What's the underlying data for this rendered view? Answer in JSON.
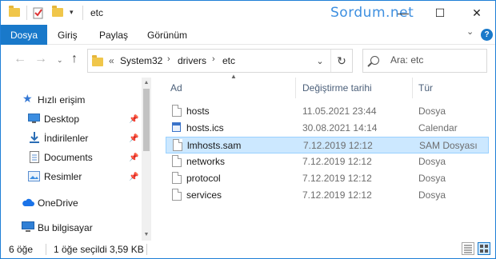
{
  "window": {
    "title": "etc",
    "watermark": "Sordum.net",
    "controls": {
      "minimize": "—",
      "maximize": "☐",
      "close": "✕"
    }
  },
  "ribbon": {
    "file_tab": "Dosya",
    "tabs": [
      "Giriş",
      "Paylaş",
      "Görünüm"
    ]
  },
  "address": {
    "prefix": "«",
    "crumbs": [
      "System32",
      "drivers",
      "etc"
    ]
  },
  "search": {
    "placeholder": "Ara: etc"
  },
  "nav_pane": {
    "quick_access": "Hızlı erişim",
    "pinned": [
      "Desktop",
      "İndirilenler",
      "Documents",
      "Resimler"
    ],
    "onedrive": "OneDrive",
    "this_pc": "Bu bilgisayar"
  },
  "file_list": {
    "columns": {
      "name": "Ad",
      "date": "Değiştirme tarihi",
      "type": "Tür"
    },
    "rows": [
      {
        "name": "hosts",
        "date": "11.05.2021 23:44",
        "type": "Dosya",
        "icon": "file-icon"
      },
      {
        "name": "hosts.ics",
        "date": "30.08.2021 14:14",
        "type": "Calendar",
        "icon": "calendar-file-icon"
      },
      {
        "name": "lmhosts.sam",
        "date": "7.12.2019 12:12",
        "type": "SAM Dosyası",
        "icon": "file-icon",
        "selected": true
      },
      {
        "name": "networks",
        "date": "7.12.2019 12:12",
        "type": "Dosya",
        "icon": "file-icon"
      },
      {
        "name": "protocol",
        "date": "7.12.2019 12:12",
        "type": "Dosya",
        "icon": "file-icon"
      },
      {
        "name": "services",
        "date": "7.12.2019 12:12",
        "type": "Dosya",
        "icon": "file-icon"
      }
    ]
  },
  "status": {
    "item_count": "6 öğe",
    "selection": "1 öğe seçildi",
    "size": "3,59 KB"
  },
  "colors": {
    "accent": "#1979ca",
    "selection_bg": "#cce8ff",
    "selection_border": "#99d1ff",
    "watermark": "#3d8fe0"
  }
}
